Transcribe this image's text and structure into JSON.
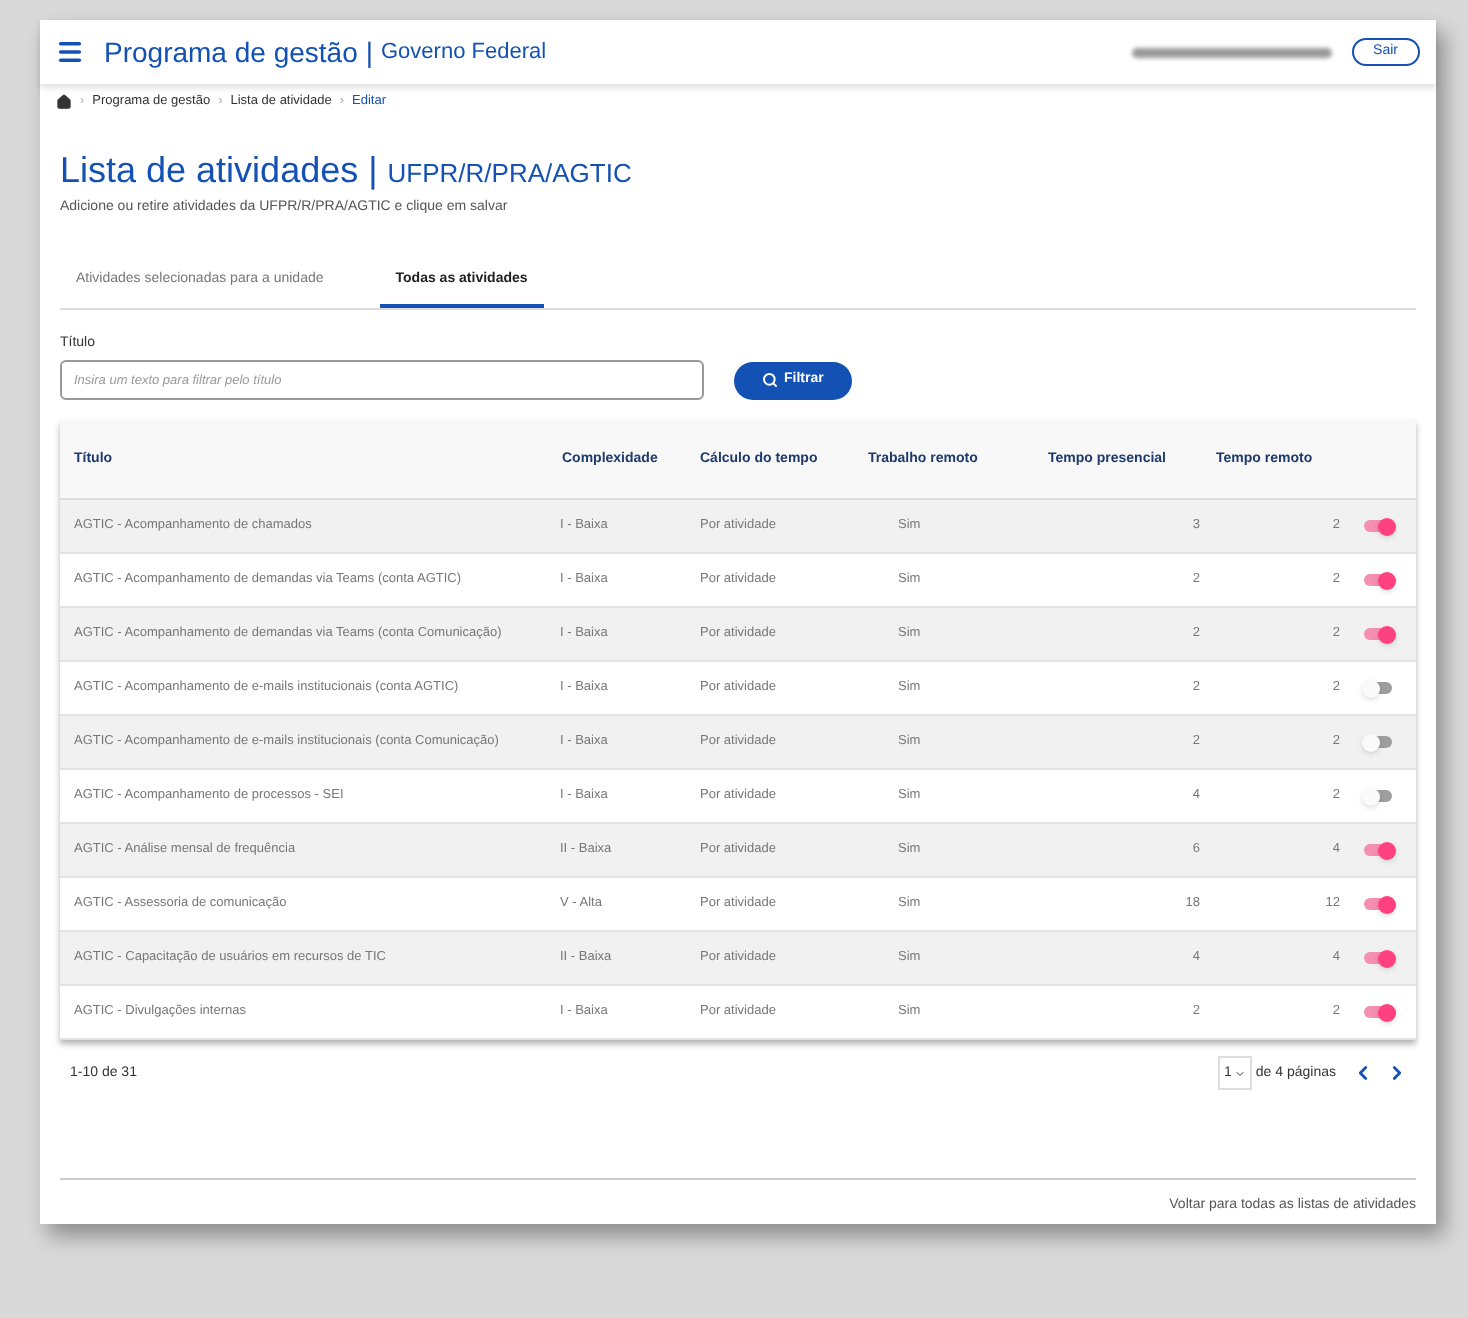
{
  "header": {
    "app_title": "Programa de gestão",
    "divider": "|",
    "org": "Governo Federal",
    "logout": "Sair"
  },
  "breadcrumb": {
    "separators": [
      "›",
      "›",
      "›"
    ],
    "items": [
      {
        "label": "Programa de gestão",
        "current": false
      },
      {
        "label": "Lista de atividade",
        "current": false
      },
      {
        "label": "Editar",
        "current": true
      }
    ]
  },
  "page": {
    "title": "Lista de atividades",
    "divider": "|",
    "unit": "UFPR/R/PRA/AGTIC",
    "subtitle": "Adicione ou retire atividades da UFPR/R/PRA/AGTIC e clique em salvar"
  },
  "tabs": [
    {
      "label": "Atividades selecionadas para a unidade",
      "selected": false
    },
    {
      "label": "Todas as atividades",
      "selected": true
    }
  ],
  "filter": {
    "label": "Título",
    "placeholder": "Insira um texto para filtrar pelo título",
    "button": "Filtrar"
  },
  "table": {
    "columns": [
      "Título",
      "Complexidade",
      "Cálculo do tempo",
      "Trabalho remoto",
      "Tempo presencial",
      "Tempo remoto"
    ],
    "rows": [
      {
        "title": "AGTIC - Acompanhamento de chamados",
        "complexity": "I - Baixa",
        "calc": "Por atividade",
        "remote": "Sim",
        "presencial": "3",
        "remote_time": "2",
        "on": true
      },
      {
        "title": "AGTIC - Acompanhamento de demandas via Teams (conta AGTIC)",
        "complexity": "I - Baixa",
        "calc": "Por atividade",
        "remote": "Sim",
        "presencial": "2",
        "remote_time": "2",
        "on": true
      },
      {
        "title": "AGTIC - Acompanhamento de demandas via Teams (conta Comunicação)",
        "complexity": "I - Baixa",
        "calc": "Por atividade",
        "remote": "Sim",
        "presencial": "2",
        "remote_time": "2",
        "on": true
      },
      {
        "title": "AGTIC - Acompanhamento de e-mails institucionais (conta AGTIC)",
        "complexity": "I - Baixa",
        "calc": "Por atividade",
        "remote": "Sim",
        "presencial": "2",
        "remote_time": "2",
        "on": false
      },
      {
        "title": "AGTIC - Acompanhamento de e-mails institucionais (conta Comunicação)",
        "complexity": "I - Baixa",
        "calc": "Por atividade",
        "remote": "Sim",
        "presencial": "2",
        "remote_time": "2",
        "on": false
      },
      {
        "title": "AGTIC - Acompanhamento de processos - SEI",
        "complexity": "I - Baixa",
        "calc": "Por atividade",
        "remote": "Sim",
        "presencial": "4",
        "remote_time": "2",
        "on": false
      },
      {
        "title": "AGTIC - Análise mensal de frequência",
        "complexity": "II - Baixa",
        "calc": "Por atividade",
        "remote": "Sim",
        "presencial": "6",
        "remote_time": "4",
        "on": true
      },
      {
        "title": "AGTIC - Assessoria de comunicação",
        "complexity": "V - Alta",
        "calc": "Por atividade",
        "remote": "Sim",
        "presencial": "18",
        "remote_time": "12",
        "on": true
      },
      {
        "title": "AGTIC - Capacitação de usuários em recursos de TIC",
        "complexity": "II - Baixa",
        "calc": "Por atividade",
        "remote": "Sim",
        "presencial": "4",
        "remote_time": "4",
        "on": true
      },
      {
        "title": "AGTIC - Divulgações internas",
        "complexity": "I - Baixa",
        "calc": "Por atividade",
        "remote": "Sim",
        "presencial": "2",
        "remote_time": "2",
        "on": true
      }
    ]
  },
  "pagination": {
    "range": "1-10 de 31",
    "page": "1",
    "pages": "de 4 páginas"
  },
  "footer_link": "Voltar para todas as listas de atividades"
}
